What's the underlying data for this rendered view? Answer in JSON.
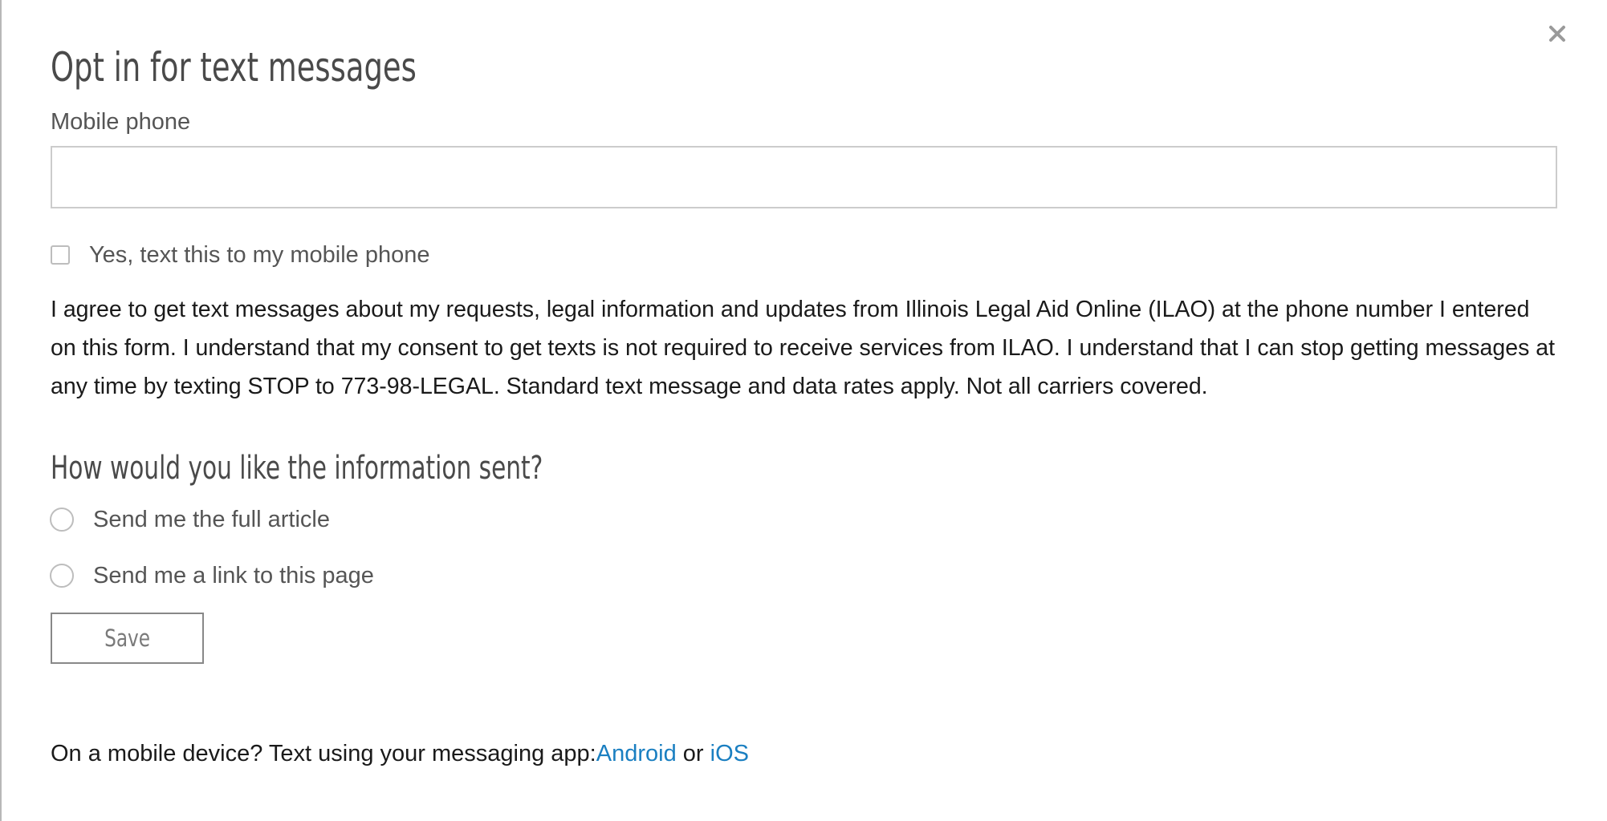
{
  "modal": {
    "title": "Opt in for text messages",
    "close_icon": "close-icon",
    "phone": {
      "label": "Mobile phone",
      "value": "",
      "placeholder": ""
    },
    "checkbox": {
      "label": "Yes, text this to my mobile phone",
      "checked": false
    },
    "consent_text": "I agree to get text messages about my requests, legal information and updates from Illinois Legal Aid Online (ILAO) at the phone number I entered on this form. I understand that my consent to get texts is not required to receive services from ILAO. I understand that I can stop getting messages at any time by texting STOP to 773-98-LEGAL. Standard text message and data rates apply. Not all carriers covered.",
    "delivery": {
      "heading": "How would you like the information sent?",
      "options": [
        {
          "label": "Send me the full article",
          "selected": false
        },
        {
          "label": "Send me a link to this page",
          "selected": false
        }
      ]
    },
    "save_label": "Save",
    "mobile_prompt": "On a mobile device? Text using your messaging app:",
    "android_label": "Android",
    "or_text": " or ",
    "ios_label": "iOS"
  },
  "colors": {
    "link": "#1a7fc1",
    "heading": "#4a4a4a",
    "border": "#cccccc"
  }
}
